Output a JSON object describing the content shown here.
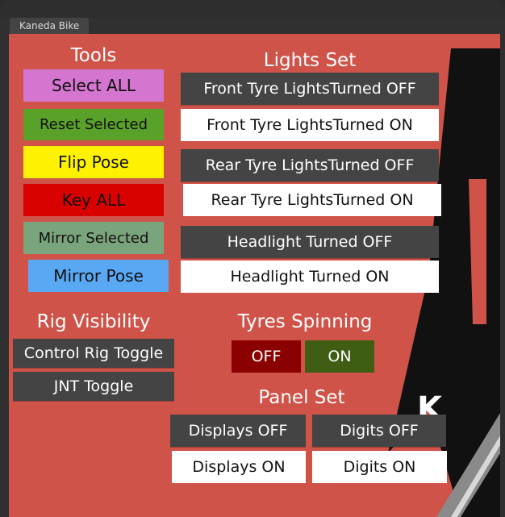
{
  "window": {
    "tab_label": "Kaneda Bike",
    "background_logo_letters": "K A"
  },
  "tools": {
    "title": "Tools",
    "buttons": [
      {
        "label": "Select ALL",
        "color": "#d475d0"
      },
      {
        "label": "Reset Selected",
        "color": "#5aa12a"
      },
      {
        "label": "Flip Pose",
        "color": "#fff200"
      },
      {
        "label": "Key ALL",
        "color": "#d90000"
      },
      {
        "label": "Mirror Selected",
        "color": "#79a47c"
      },
      {
        "label": "Mirror Pose",
        "color": "#58a8f4"
      }
    ]
  },
  "lights": {
    "title": "Lights Set",
    "buttons": [
      {
        "label": "Front Tyre LightsTurned OFF"
      },
      {
        "label": "Front Tyre LightsTurned ON"
      },
      {
        "label": "Rear Tyre LightsTurned OFF"
      },
      {
        "label": "Rear Tyre LightsTurned ON"
      },
      {
        "label": "Headlight Turned OFF"
      },
      {
        "label": "Headlight Turned ON"
      }
    ]
  },
  "rig_visibility": {
    "title": "Rig Visibility",
    "buttons": [
      {
        "label": "Control Rig Toggle"
      },
      {
        "label": "JNT Toggle"
      }
    ]
  },
  "tyres_spinning": {
    "title": "Tyres Spinning",
    "off_label": "OFF",
    "on_label": "ON",
    "off_color": "#8b0000",
    "on_color": "#3f5e14"
  },
  "panel_set": {
    "title": "Panel Set",
    "buttons": [
      {
        "label": "Displays OFF"
      },
      {
        "label": "Digits OFF"
      },
      {
        "label": "Displays ON"
      },
      {
        "label": "Digits ON"
      }
    ]
  },
  "colors": {
    "panel_bg": "#cf5349",
    "dark_button": "#444444",
    "light_button": "#ffffff"
  }
}
